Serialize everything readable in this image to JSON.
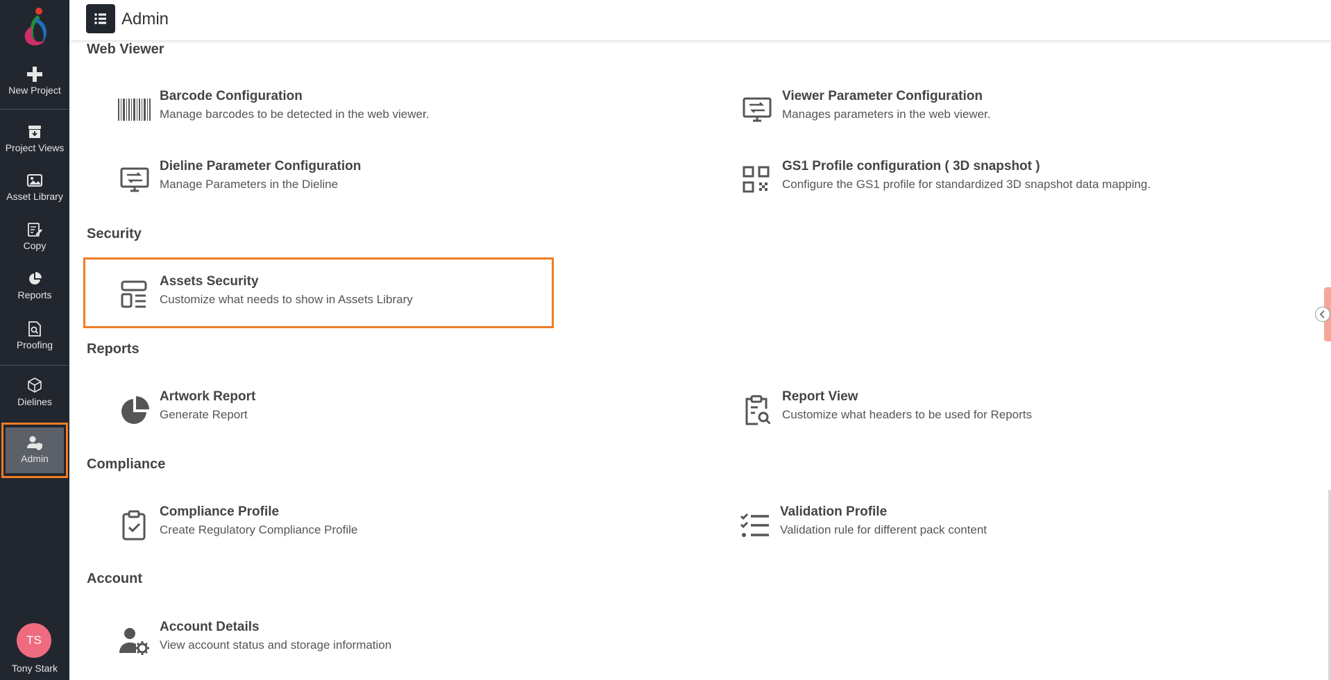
{
  "sidebar": {
    "items": [
      {
        "label": "New Project",
        "icon": "plus-icon"
      },
      {
        "label": "Project Views",
        "icon": "archive-icon"
      },
      {
        "label": "Asset Library",
        "icon": "image-icon"
      },
      {
        "label": "Copy",
        "icon": "edit-document-icon"
      },
      {
        "label": "Reports",
        "icon": "pie-chart-icon"
      },
      {
        "label": "Proofing",
        "icon": "search-document-icon"
      },
      {
        "label": "Dielines",
        "icon": "cube-icon"
      },
      {
        "label": "Admin",
        "icon": "user-shield-icon",
        "active": true
      }
    ],
    "user": {
      "initials": "TS",
      "name": "Tony Stark"
    }
  },
  "header": {
    "title": "Admin"
  },
  "sections": {
    "web_viewer": {
      "title": "Web Viewer",
      "cards": [
        {
          "title": "Barcode Configuration",
          "desc": "Manage barcodes to be detected in the web viewer.",
          "icon": "barcode-icon"
        },
        {
          "title": "Viewer Parameter Configuration",
          "desc": "Manages parameters in the web viewer.",
          "icon": "monitor-settings-icon"
        },
        {
          "title": "Dieline Parameter Configuration",
          "desc": "Manage Parameters in the Dieline",
          "icon": "monitor-settings-icon"
        },
        {
          "title": "GS1 Profile configuration ( 3D snapshot )",
          "desc": "Configure the GS1 profile for standardized 3D snapshot data mapping.",
          "icon": "qr-code-icon"
        }
      ]
    },
    "security": {
      "title": "Security",
      "cards": [
        {
          "title": "Assets Security",
          "desc": "Customize what needs to show in Assets Library",
          "icon": "layout-list-icon"
        }
      ]
    },
    "reports": {
      "title": "Reports",
      "cards": [
        {
          "title": "Artwork Report",
          "desc": "Generate Report",
          "icon": "pie-chart-icon"
        },
        {
          "title": "Report View",
          "desc": "Customize what headers to be used for Reports",
          "icon": "clipboard-search-icon"
        }
      ]
    },
    "compliance": {
      "title": "Compliance",
      "cards": [
        {
          "title": "Compliance Profile",
          "desc": "Create Regulatory Compliance Profile",
          "icon": "clipboard-check-icon"
        },
        {
          "title": "Validation Profile",
          "desc": "Validation rule for different pack content",
          "icon": "checklist-icon"
        }
      ]
    },
    "account": {
      "title": "Account",
      "cards": [
        {
          "title": "Account Details",
          "desc": "View account status and storage information",
          "icon": "user-gear-icon"
        }
      ]
    }
  },
  "colors": {
    "sidebar_bg": "#22262e",
    "highlight": "#f07c24",
    "avatar": "#ef6b80"
  }
}
